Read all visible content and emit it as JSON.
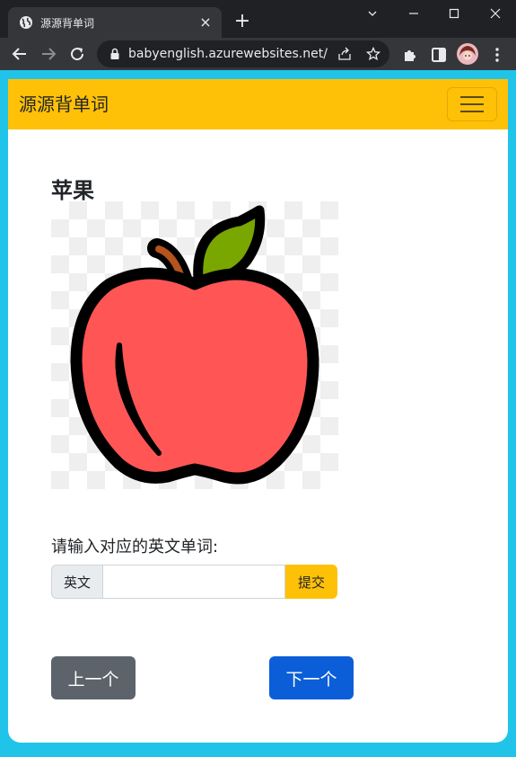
{
  "browser": {
    "tab_title": "源源背单词",
    "url": "babyenglish.azurewebsites.net/...",
    "new_tab": "+",
    "tab_close": "×"
  },
  "navbar": {
    "brand": "源源背单词"
  },
  "word": {
    "chinese": "苹果",
    "image_icon": "apple-icon"
  },
  "form": {
    "prompt": "请输入对应的英文单词:",
    "addon_label": "英文",
    "answer_value": "",
    "submit_label": "提交"
  },
  "pager": {
    "prev_label": "上一个",
    "next_label": "下一个"
  },
  "colors": {
    "navbar_bg": "#ffc107",
    "prev_bg": "#5c636a",
    "next_bg": "#0b5ed7",
    "apple_red": "#ff5555",
    "leaf_green": "#7aa600"
  }
}
